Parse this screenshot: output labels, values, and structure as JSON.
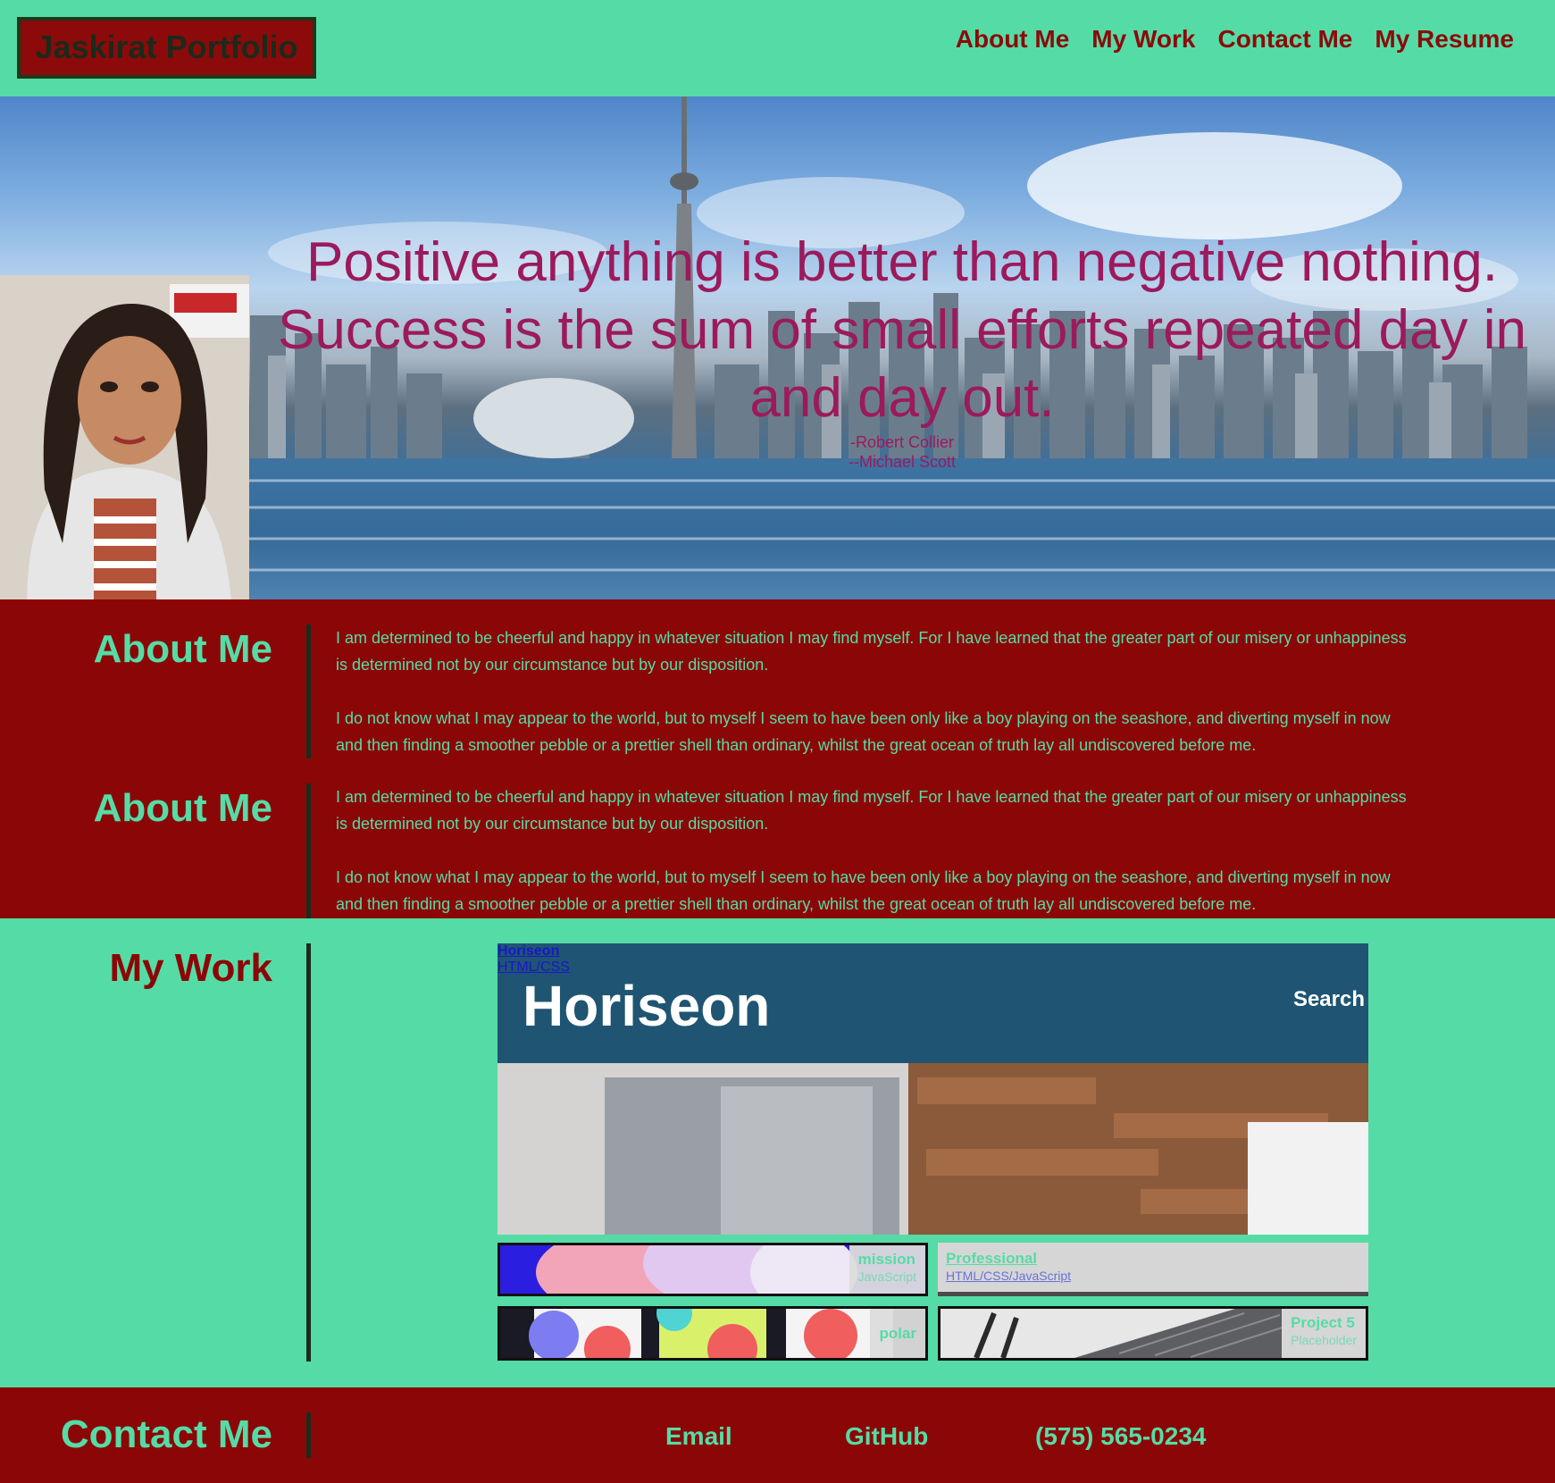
{
  "header": {
    "logo": "Jaskirat Portfolio",
    "nav": [
      "About Me",
      "My Work",
      "Contact Me",
      "My Resume"
    ]
  },
  "hero": {
    "quote": "Positive anything is better than negative nothing. Success is the sum of small efforts repeated day in and day out.",
    "author1": "-Robert Collier",
    "author2": "--Michael Scott"
  },
  "about": [
    {
      "title": "About Me",
      "paragraphs": [
        "I am determined to be cheerful and happy in whatever situation I may find myself. For I have learned that the greater part of our misery or unhappiness is determined not by our circumstance but by our disposition.",
        "I do not know what I may appear to the world, but to myself I seem to have been only like a boy playing on the seashore, and diverting myself in now and then finding a smoother pebble or a prettier shell than ordinary, whilst the great ocean of truth lay all undiscovered before me."
      ]
    },
    {
      "title": "About Me",
      "paragraphs": [
        "I am determined to be cheerful and happy in whatever situation I may find myself. For I have learned that the greater part of our misery or unhappiness is determined not by our circumstance but by our disposition.",
        "I do not know what I may appear to the world, but to myself I seem to have been only like a boy playing on the seashore, and diverting myself in now and then finding a smoother pebble or a prettier shell than ordinary, whilst the great ocean of truth lay all undiscovered before me."
      ]
    }
  ],
  "work": {
    "title": "My Work",
    "main": {
      "title": "Horiseon",
      "subtitle": "HTML/CSS",
      "brand": "Horiseon",
      "search": "Search"
    },
    "projects": [
      {
        "title": "mission",
        "subtitle": "JavaScript"
      },
      {
        "title": "Professional",
        "subtitle": "HTML/CSS/JavaScript"
      },
      {
        "title": "polar",
        "subtitle": ""
      },
      {
        "title": "Project 5",
        "subtitle": "Placeholder"
      }
    ]
  },
  "contact": {
    "title": "Contact Me",
    "email": "Email",
    "github": "GitHub",
    "phone": "(575) 565-0234"
  },
  "colors": {
    "accent_green": "#55dca6",
    "dark_red": "#8b0707",
    "quote_magenta": "#9c1a5c",
    "link_blue": "#1a17c8"
  }
}
